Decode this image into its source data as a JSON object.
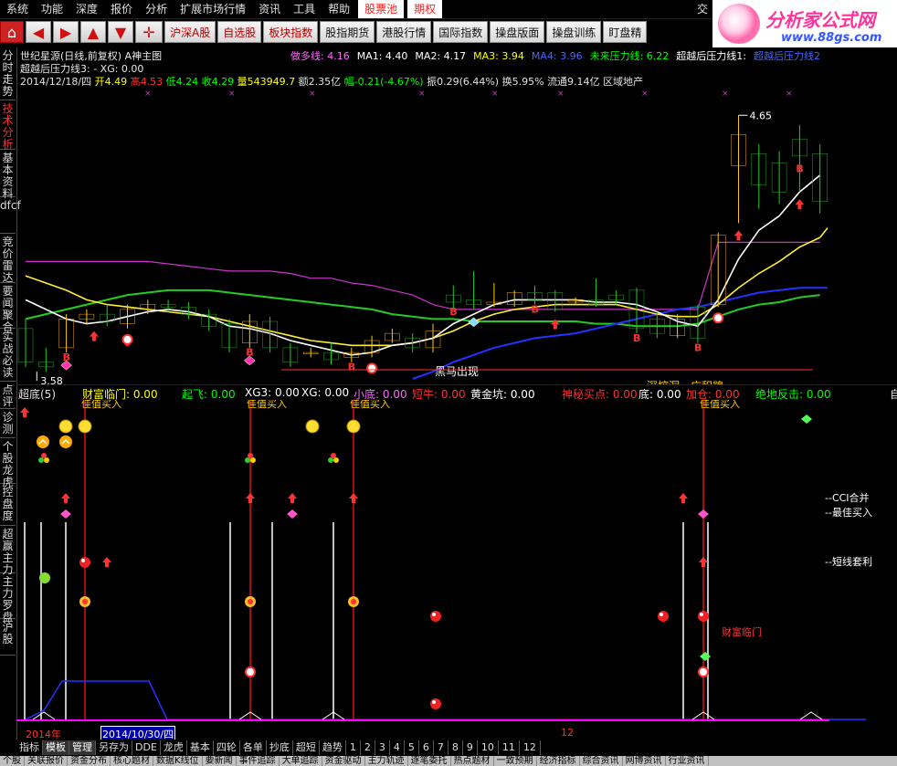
{
  "menu": {
    "items": [
      "系统",
      "功能",
      "深度",
      "报价",
      "分析",
      "扩展市场行情",
      "资讯",
      "工具",
      "帮助",
      "股票池",
      "期权"
    ],
    "red_items": [
      "股票池",
      "期权"
    ],
    "right_text": "交"
  },
  "toolbar": {
    "buttons": [
      "沪深A股",
      "自选股",
      "板块指数",
      "股指期货",
      "港股行情",
      "国际指数",
      "操盘版面",
      "操盘训练",
      "盯盘精"
    ]
  },
  "logo": {
    "title": "分析家公式网",
    "url": "www.88gs.com"
  },
  "sidebar": {
    "tabs": [
      "分时走势",
      "技术分析",
      "基本资料",
      "dfcf",
      "竞价雷达",
      "要闻聚合",
      "实战必读",
      "点评",
      "诊测",
      "个股龙虎",
      "控盘度",
      "超赢主力",
      "主力罗盘",
      "沪股"
    ],
    "active_index": 1
  },
  "header": {
    "title": "世纪星源(日线,前复权) A神主图",
    "line1": [
      {
        "label": "做多线: 4.16",
        "color": "#ff66ff"
      },
      {
        "label": "MA1: 4.40",
        "color": "#ffffff"
      },
      {
        "label": "MA2: 4.17",
        "color": "#ffffff"
      },
      {
        "label": "MA3: 3.94",
        "color": "#ffff00"
      },
      {
        "label": "MA4: 3.96",
        "color": "#4466ff"
      },
      {
        "label": "未来压力线: 6.22",
        "color": "#00ff00"
      },
      {
        "label": "超越后压力线1:",
        "color": "#ffffff"
      },
      {
        "label": "超越后压力线2",
        "color": "#4466ff"
      }
    ],
    "line2": "超越后压力线3: - XG: 0.00",
    "quote": {
      "date": "2014/12/18/四",
      "open": "开4.49",
      "high": "高4.53",
      "low": "低4.24",
      "close": "收4.29",
      "vol": "量543949.7",
      "amount": "额2.35亿",
      "change": "幅-0.21(-4.67%)",
      "amp": "振0.29(6.44%)",
      "turnover": "换5.95%",
      "float": "流通9.14亿",
      "sector": "区域地产"
    }
  },
  "annotations": {
    "high_label": "4.65",
    "low_label": "3.58",
    "black_horse": "黑马出现",
    "deep_dig": "深挖洞，广积粮",
    "buy_signal": "B",
    "ind_right": [
      "--CCI合并",
      "--最佳买入",
      "--短线套利"
    ],
    "wealth_label": "财富临门",
    "best_buy": "佳值买入"
  },
  "indicator": {
    "name": "超底(5)",
    "fields": [
      {
        "label": "财富临门: 0.00",
        "color": "#ffff00"
      },
      {
        "label": "起飞: 0.00",
        "color": "#00ff00"
      },
      {
        "label": "XG3: 0.00",
        "color": "#ffffff"
      },
      {
        "label": "XG: 0.00",
        "color": "#ffffff"
      },
      {
        "label": "小底: 0.00",
        "color": "#ff66ff"
      },
      {
        "label": "短牛: 0.00",
        "color": "#ff3030"
      },
      {
        "label": "黄金坑: 0.00",
        "color": "#ffffff"
      },
      {
        "label": "神秘买点: 0.00",
        "color": "#ff3030"
      },
      {
        "label": "底: 0.00",
        "color": "#ffffff"
      },
      {
        "label": "加仓: 0.00",
        "color": "#ff3030"
      },
      {
        "label": "绝地反击: 0.00",
        "color": "#00ff00"
      }
    ],
    "right_cut": "自"
  },
  "time_axis": {
    "year_label": "2014年",
    "date_label": "2014/10/30/四",
    "month_label": "12"
  },
  "bottom_tabs": [
    "指标",
    "模板",
    "管理",
    "另存为",
    "DDE",
    "龙虎",
    "基本",
    "四轮",
    "各单",
    "抄底",
    "超短",
    "趋势",
    "1",
    "2",
    "3",
    "4",
    "5",
    "6",
    "7",
    "8",
    "9",
    "10",
    "11",
    "12"
  ],
  "bottom_selected": [
    "模板",
    "管理"
  ],
  "status_tabs": [
    "个股",
    "关联报价",
    "资金分布",
    "核心题材",
    "数据K线位",
    "要新闻",
    "事件追踪",
    "大单追踪",
    "资金驱动",
    "主力轨迹",
    "逐笔委托",
    "热点题材",
    "一致预期",
    "经济指标",
    "综合资讯",
    "网博资讯",
    "行业资讯"
  ],
  "chart_data": {
    "type": "candlestick",
    "price_range": [
      3.55,
      4.75
    ],
    "candles": [
      {
        "o": 3.76,
        "c": 3.62,
        "h": 3.8,
        "l": 3.6
      },
      {
        "o": 3.62,
        "c": 3.6,
        "h": 3.68,
        "l": 3.58
      },
      {
        "o": 3.68,
        "c": 3.8,
        "h": 3.82,
        "l": 3.66
      },
      {
        "o": 3.8,
        "c": 3.82,
        "h": 3.84,
        "l": 3.78
      },
      {
        "o": 3.82,
        "c": 3.79,
        "h": 3.86,
        "l": 3.77
      },
      {
        "o": 3.78,
        "c": 3.84,
        "h": 3.86,
        "l": 3.76
      },
      {
        "o": 3.84,
        "c": 3.86,
        "h": 3.88,
        "l": 3.82
      },
      {
        "o": 3.86,
        "c": 3.85,
        "h": 3.88,
        "l": 3.83
      },
      {
        "o": 3.85,
        "c": 3.82,
        "h": 3.87,
        "l": 3.8
      },
      {
        "o": 3.82,
        "c": 3.77,
        "h": 3.84,
        "l": 3.75
      },
      {
        "o": 3.78,
        "c": 3.68,
        "h": 3.8,
        "l": 3.66
      },
      {
        "o": 3.7,
        "c": 3.79,
        "h": 3.82,
        "l": 3.68
      },
      {
        "o": 3.79,
        "c": 3.68,
        "h": 3.81,
        "l": 3.66
      },
      {
        "o": 3.68,
        "c": 3.62,
        "h": 3.7,
        "l": 3.6
      },
      {
        "o": 3.66,
        "c": 3.66,
        "h": 3.68,
        "l": 3.64
      },
      {
        "o": 3.66,
        "c": 3.63,
        "h": 3.7,
        "l": 3.61
      },
      {
        "o": 3.64,
        "c": 3.66,
        "h": 3.68,
        "l": 3.62
      },
      {
        "o": 3.66,
        "c": 3.71,
        "h": 3.73,
        "l": 3.64
      },
      {
        "o": 3.71,
        "c": 3.74,
        "h": 3.76,
        "l": 3.7
      },
      {
        "o": 3.72,
        "c": 3.68,
        "h": 3.74,
        "l": 3.66
      },
      {
        "o": 3.68,
        "c": 3.75,
        "h": 3.78,
        "l": 3.66
      },
      {
        "o": 3.9,
        "c": 3.87,
        "h": 3.94,
        "l": 3.84
      },
      {
        "o": 3.88,
        "c": 3.86,
        "h": 4.0,
        "l": 3.84
      },
      {
        "o": 3.86,
        "c": 3.87,
        "h": 3.95,
        "l": 3.85
      },
      {
        "o": 3.86,
        "c": 3.91,
        "h": 3.92,
        "l": 3.85
      },
      {
        "o": 3.91,
        "c": 3.88,
        "h": 3.94,
        "l": 3.86
      },
      {
        "o": 3.91,
        "c": 3.84,
        "h": 3.92,
        "l": 3.83
      },
      {
        "o": 3.87,
        "c": 3.88,
        "h": 3.89,
        "l": 3.86
      },
      {
        "o": 3.88,
        "c": 3.86,
        "h": 3.97,
        "l": 3.85
      },
      {
        "o": 3.9,
        "c": 3.88,
        "h": 3.92,
        "l": 3.86
      },
      {
        "o": 3.92,
        "c": 3.76,
        "h": 3.93,
        "l": 3.74
      },
      {
        "o": 3.8,
        "c": 3.74,
        "h": 3.83,
        "l": 3.72
      },
      {
        "o": 3.73,
        "c": 3.8,
        "h": 3.82,
        "l": 3.72
      },
      {
        "o": 3.85,
        "c": 3.72,
        "h": 3.86,
        "l": 3.7
      },
      {
        "o": 3.86,
        "c": 4.15,
        "h": 4.16,
        "l": 3.85
      },
      {
        "o": 4.44,
        "c": 4.57,
        "h": 4.65,
        "l": 4.2
      },
      {
        "o": 4.49,
        "c": 4.36,
        "h": 4.53,
        "l": 4.26
      },
      {
        "o": 4.45,
        "c": 4.33,
        "h": 4.5,
        "l": 4.28
      },
      {
        "o": 4.55,
        "c": 4.48,
        "h": 4.61,
        "l": 4.33
      },
      {
        "o": 4.49,
        "c": 4.29,
        "h": 4.53,
        "l": 4.24
      }
    ],
    "lines": {
      "white": [
        3.88,
        3.84,
        3.8,
        3.78,
        3.79,
        3.81,
        3.83,
        3.84,
        3.83,
        3.81,
        3.77,
        3.76,
        3.74,
        3.71,
        3.69,
        3.67,
        3.65,
        3.66,
        3.69,
        3.7,
        3.72,
        3.78,
        3.82,
        3.86,
        3.88,
        3.88,
        3.88,
        3.88,
        3.87,
        3.87,
        3.86,
        3.83,
        3.79,
        3.77,
        3.88,
        4.05,
        4.17,
        4.23,
        4.33,
        4.4
      ],
      "yellow": [
        3.98,
        3.95,
        3.92,
        3.88,
        3.86,
        3.85,
        3.84,
        3.83,
        3.82,
        3.81,
        3.79,
        3.77,
        3.75,
        3.73,
        3.71,
        3.7,
        3.69,
        3.69,
        3.69,
        3.7,
        3.72,
        3.75,
        3.79,
        3.82,
        3.84,
        3.85,
        3.86,
        3.86,
        3.86,
        3.86,
        3.84,
        3.82,
        3.81,
        3.81,
        3.86,
        3.93,
        3.99,
        4.04,
        4.1,
        4.14
      ],
      "green": [
        3.8,
        3.82,
        3.84,
        3.86,
        3.88,
        3.9,
        3.91,
        3.92,
        3.92,
        3.92,
        3.91,
        3.9,
        3.89,
        3.88,
        3.87,
        3.86,
        3.85,
        3.84,
        3.82,
        3.81,
        3.8,
        3.8,
        3.79,
        3.79,
        3.79,
        3.79,
        3.79,
        3.79,
        3.78,
        3.78,
        3.77,
        3.77,
        3.77,
        3.78,
        3.81,
        3.84,
        3.86,
        3.87,
        3.89,
        3.9
      ],
      "blue": [
        null,
        null,
        null,
        null,
        null,
        null,
        null,
        null,
        null,
        null,
        null,
        null,
        null,
        null,
        null,
        null,
        null,
        null,
        null,
        3.55,
        3.58,
        3.62,
        3.65,
        3.68,
        3.7,
        3.72,
        3.73,
        3.74,
        3.76,
        3.78,
        3.8,
        3.82,
        3.84,
        3.85,
        3.87,
        3.89,
        3.91,
        3.92,
        3.93,
        3.93
      ],
      "magenta": [
        4.04,
        4.04,
        4.04,
        4.04,
        4.04,
        4.04,
        4.04,
        4.03,
        4.02,
        4.01,
        4.0,
        4.0,
        4.0,
        3.99,
        3.97,
        3.97,
        3.95,
        3.94,
        3.92,
        3.9,
        3.86,
        3.84,
        3.84,
        3.84,
        3.84,
        3.84,
        3.84,
        3.84,
        3.84,
        3.84,
        3.84,
        3.84,
        3.84,
        3.84,
        4.12,
        4.12,
        4.12,
        4.12,
        4.12,
        4.12
      ]
    }
  }
}
